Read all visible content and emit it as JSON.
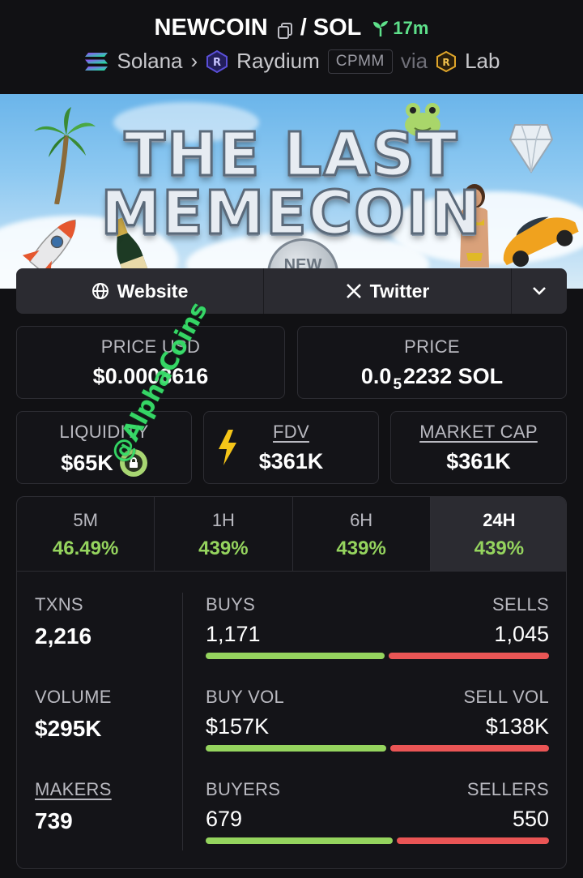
{
  "header": {
    "token": "NEWCOIN",
    "separator": "/",
    "quote": "SOL",
    "age": "17m",
    "chain": "Solana",
    "dex": "Raydium",
    "pool_type": "CPMM",
    "via_label": "via",
    "launchpad": "Lab"
  },
  "banner": {
    "line1": "THE LAST",
    "line2": "MEMECOIN",
    "coin_text": "NEW"
  },
  "social": {
    "website": "Website",
    "twitter": "Twitter"
  },
  "price_usd": {
    "label": "PRICE USD",
    "value": "$0.0003616"
  },
  "price_sol": {
    "label": "PRICE",
    "prefix": "0.0",
    "zeros": "5",
    "suffix": "2232 SOL"
  },
  "liquidity": {
    "label": "LIQUIDITY",
    "value": "$65K"
  },
  "fdv": {
    "label": "FDV",
    "value": "$361K"
  },
  "market_cap": {
    "label": "MARKET CAP",
    "value": "$361K"
  },
  "tabs": [
    {
      "label": "5M",
      "value": "46.49%"
    },
    {
      "label": "1H",
      "value": "439%"
    },
    {
      "label": "6H",
      "value": "439%"
    },
    {
      "label": "24H",
      "value": "439%",
      "active": true
    }
  ],
  "txns": {
    "label": "TXNS",
    "value": "2,216"
  },
  "volume": {
    "label": "VOLUME",
    "value": "$295K"
  },
  "makers": {
    "label": "MAKERS",
    "value": "739"
  },
  "buys": {
    "label_left": "BUYS",
    "label_right": "SELLS",
    "left": "1,171",
    "right": "1,045",
    "left_share": 0.528
  },
  "vol_split": {
    "label_left": "BUY VOL",
    "label_right": "SELL VOL",
    "left": "$157K",
    "right": "$138K",
    "left_share": 0.532
  },
  "buyers": {
    "label_left": "BUYERS",
    "label_right": "SELLERS",
    "left": "679",
    "right": "550",
    "left_share": 0.552
  },
  "watermark": "@AlphaCoins",
  "colors": {
    "positive": "#95d45e",
    "negative": "#ea5555",
    "age": "#5ee08a",
    "background": "#111114"
  }
}
